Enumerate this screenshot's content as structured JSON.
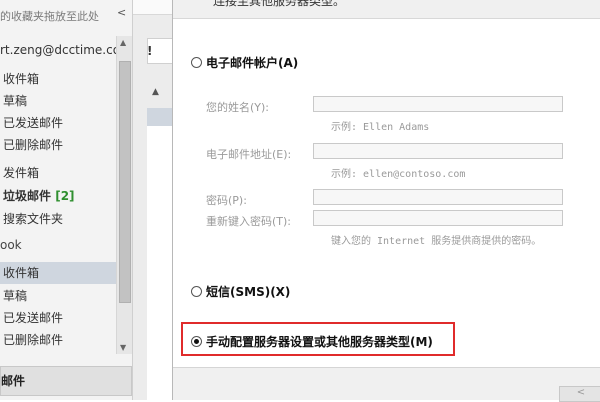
{
  "folder_pane": {
    "favorites_hint": "的收藏夹拖放至此处",
    "collapse_arrow": "<",
    "account": "rt.zeng@dcctime.co",
    "account_folders": [
      {
        "label": "收件箱"
      },
      {
        "label": "草稿"
      },
      {
        "label": "已发送邮件"
      },
      {
        "label": "已删除邮件"
      },
      {
        "label": "发件箱"
      },
      {
        "label": "垃圾邮件",
        "count": "[2]"
      },
      {
        "label": "搜索文件夹"
      }
    ],
    "section_label": "ook",
    "section_folders": [
      {
        "label": "收件箱"
      },
      {
        "label": "草稿"
      },
      {
        "label": "已发送邮件"
      },
      {
        "label": "已删除邮件"
      }
    ],
    "bottom_tab": "邮件"
  },
  "message_list": {
    "importance_header": "!",
    "sort_indicator": "▲"
  },
  "dialog": {
    "description": "连接至其他服务器类型。",
    "email_account_option": "电子邮件帐户(A)",
    "fields": {
      "name_label": "您的姓名(Y):",
      "name_example": "示例: Ellen Adams",
      "email_label": "电子邮件地址(E):",
      "email_example": "示例: ellen@contoso.com",
      "password_label": "密码(P):",
      "retype_label": "重新键入密码(T):",
      "password_hint": "键入您的 Internet 服务提供商提供的密码。"
    },
    "sms_option": "短信(SMS)(X)",
    "manual_option": "手动配置服务器设置或其他服务器类型(M)",
    "selected_option": "manual",
    "next_button": "<"
  },
  "colors": {
    "highlight_border": "#e02b2b",
    "selected_folder": "#cfd6df",
    "spam_count": "#2f8f2f"
  }
}
